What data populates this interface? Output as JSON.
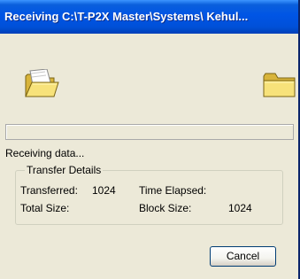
{
  "window": {
    "title": "Receiving C:\\T-P2X Master\\Systems\\ Kehul..."
  },
  "icons": {
    "source": "open-folder-icon",
    "destination": "closed-folder-icon"
  },
  "progress": {
    "fraction": 0
  },
  "status": {
    "text": "Receiving data..."
  },
  "transfer_details": {
    "title": "Transfer Details",
    "transferred_label": "Transferred:",
    "transferred_value": "1024",
    "time_elapsed_label": "Time Elapsed:",
    "time_elapsed_value": "",
    "total_size_label": "Total Size:",
    "total_size_value": "",
    "block_size_label": "Block Size:",
    "block_size_value": "1024"
  },
  "buttons": {
    "cancel": "Cancel"
  },
  "colors": {
    "title_bar": "#0055e5",
    "dialog_face": "#ece9d8",
    "folder_yellow": "#f5d85a"
  }
}
